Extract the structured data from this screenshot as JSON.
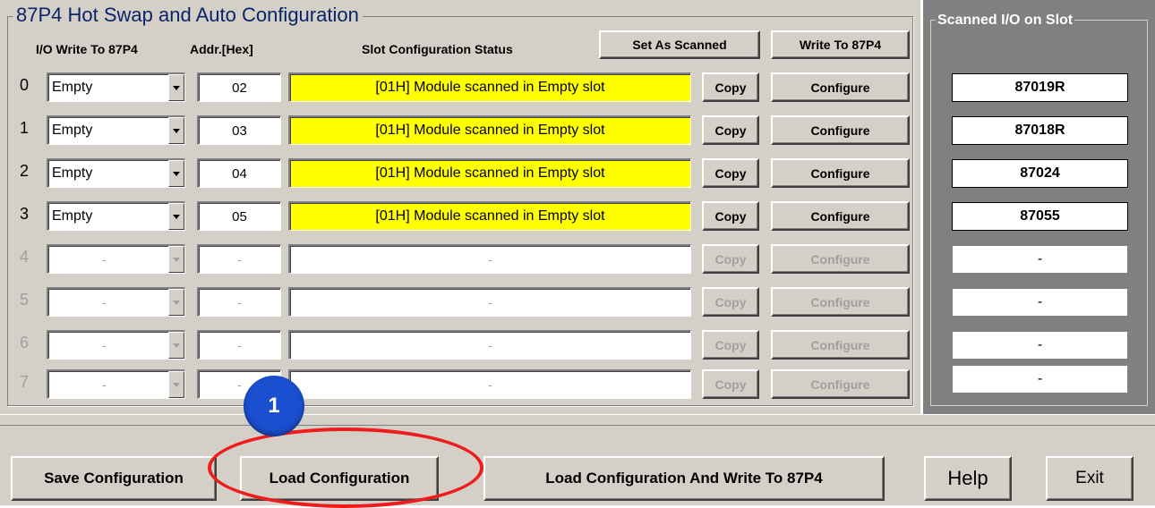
{
  "group_title": "87P4 Hot Swap and Auto Configuration",
  "headers": {
    "io_write": "I/O Write To 87P4",
    "addr": "Addr.[Hex]",
    "status": "Slot Configuration Status"
  },
  "top_buttons": {
    "set_as_scanned": "Set As Scanned",
    "write_to_87p4": "Write To 87P4"
  },
  "right_panel": {
    "title": "Scanned I/O on Slot"
  },
  "rows": [
    {
      "num": "0",
      "io": "Empty",
      "addr": "02",
      "status": "[01H] Module scanned in Empty slot",
      "copy": "Copy",
      "configure": "Configure",
      "scanned": "87019R"
    },
    {
      "num": "1",
      "io": "Empty",
      "addr": "03",
      "status": "[01H] Module scanned in Empty slot",
      "copy": "Copy",
      "configure": "Configure",
      "scanned": "87018R"
    },
    {
      "num": "2",
      "io": "Empty",
      "addr": "04",
      "status": "[01H] Module scanned in Empty slot",
      "copy": "Copy",
      "configure": "Configure",
      "scanned": "87024"
    },
    {
      "num": "3",
      "io": "Empty",
      "addr": "05",
      "status": "[01H] Module scanned in Empty slot",
      "copy": "Copy",
      "configure": "Configure",
      "scanned": "87055"
    },
    {
      "num": "4",
      "io": "-",
      "addr": "-",
      "status": "-",
      "copy": "Copy",
      "configure": "Configure",
      "scanned": "-"
    },
    {
      "num": "5",
      "io": "-",
      "addr": "-",
      "status": "-",
      "copy": "Copy",
      "configure": "Configure",
      "scanned": "-"
    },
    {
      "num": "6",
      "io": "-",
      "addr": "-",
      "status": "-",
      "copy": "Copy",
      "configure": "Configure",
      "scanned": "-"
    },
    {
      "num": "7",
      "io": "-",
      "addr": "-",
      "status": "-",
      "copy": "Copy",
      "configure": "Configure",
      "scanned": "-"
    }
  ],
  "bottom_buttons": {
    "save": "Save Configuration",
    "load": "Load Configuration",
    "load_write": "Load  Configuration And Write To 87P4",
    "help": "Help",
    "exit": "Exit"
  },
  "callout": {
    "number": "1"
  },
  "colors": {
    "status_yellow": "#ffff00",
    "title_blue": "#0a246a",
    "callout_blue": "#1a4fcf",
    "callout_red": "#ee1c1c"
  }
}
